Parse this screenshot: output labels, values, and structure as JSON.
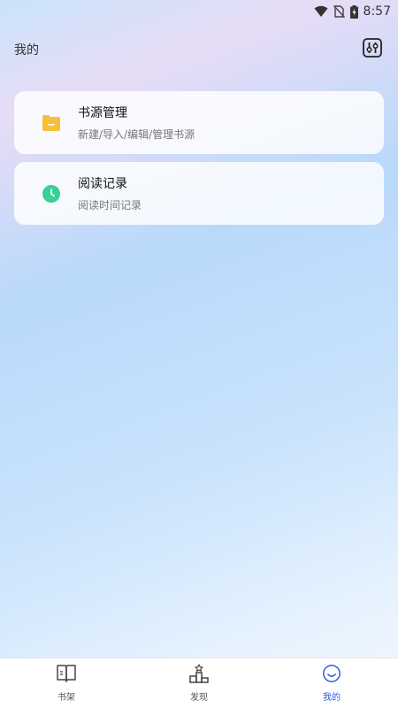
{
  "status_bar": {
    "time": "8:57",
    "icons": [
      "wifi-icon",
      "no-sim-icon",
      "battery-charging-icon"
    ]
  },
  "header": {
    "title": "我的",
    "settings_icon": "sliders-icon"
  },
  "cards": [
    {
      "title": "书源管理",
      "subtitle": "新建/导入/编辑/管理书源",
      "icon": "folder-icon",
      "icon_color": "#f6c03a"
    },
    {
      "title": "阅读记录",
      "subtitle": "阅读时间记录",
      "icon": "clock-icon",
      "icon_color": "#3ccf95"
    }
  ],
  "tabbar": {
    "active_color": "#2a5cd6",
    "tabs": [
      {
        "label": "书架",
        "icon": "book-icon",
        "active": false
      },
      {
        "label": "发现",
        "icon": "podium-icon",
        "active": false
      },
      {
        "label": "我的",
        "icon": "smile-icon",
        "active": true
      }
    ]
  }
}
